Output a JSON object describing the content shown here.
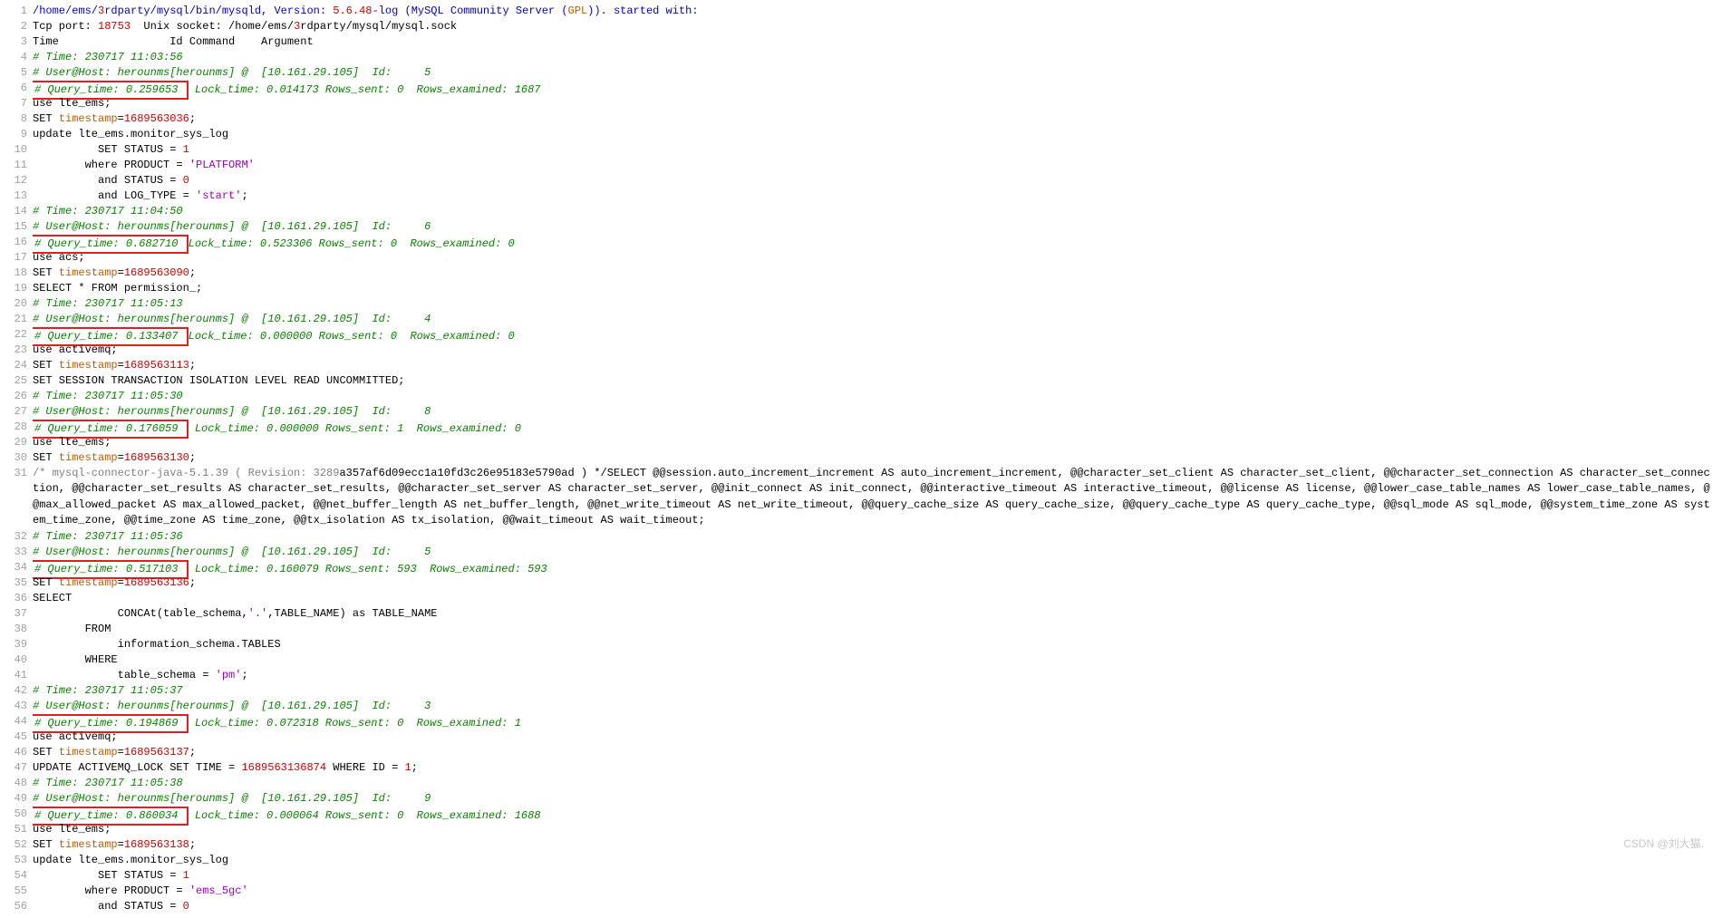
{
  "watermark": "CSDN @刘大猫.",
  "lines": [
    {
      "n": 1,
      "cls": "",
      "html": [
        {
          "t": "/home/ems/",
          "c": "blue"
        },
        {
          "t": "3",
          "c": "red"
        },
        {
          "t": "rdparty/mysql/bin/mysqld, Version: ",
          "c": "blue"
        },
        {
          "t": "5.6.48",
          "c": "red"
        },
        {
          "t": "-log (MySQL Community Server (",
          "c": "blue"
        },
        {
          "t": "GPL",
          "c": "orange"
        },
        {
          "t": ")). started with:",
          "c": "blue"
        }
      ]
    },
    {
      "n": 2,
      "cls": "",
      "html": [
        {
          "t": "Tcp port: ",
          "c": ""
        },
        {
          "t": "18753",
          "c": "red"
        },
        {
          "t": "  Unix socket: /home/ems/",
          "c": ""
        },
        {
          "t": "3",
          "c": "red"
        },
        {
          "t": "rdparty/mysql/mysql.sock",
          "c": ""
        }
      ]
    },
    {
      "n": 3,
      "cls": "",
      "html": [
        {
          "t": "Time                 Id Command    Argument",
          "c": ""
        }
      ]
    },
    {
      "n": 4,
      "cls": "green",
      "html": [
        {
          "t": "# Time: 230717 11:03:56",
          "c": "green"
        }
      ]
    },
    {
      "n": 5,
      "cls": "green",
      "html": [
        {
          "t": "# User@Host: herounms[herounms] @  [10.161.29.105]  Id:     5",
          "c": "green"
        }
      ]
    },
    {
      "n": 6,
      "cls": "green",
      "box": "# Query_time: 0.259653 ",
      "rest": " Lock_time: 0.014173 Rows_sent: 0  Rows_examined: 1687"
    },
    {
      "n": 7,
      "cls": "",
      "html": [
        {
          "t": "use lte_ems;",
          "c": ""
        }
      ]
    },
    {
      "n": 8,
      "cls": "",
      "html": [
        {
          "t": "SET ",
          "c": ""
        },
        {
          "t": "timestamp",
          "c": "orange"
        },
        {
          "t": "=",
          "c": ""
        },
        {
          "t": "1689563036",
          "c": "red"
        },
        {
          "t": ";",
          "c": ""
        }
      ]
    },
    {
      "n": 9,
      "cls": "",
      "html": [
        {
          "t": "update lte_ems.monitor_sys_log",
          "c": ""
        }
      ]
    },
    {
      "n": 10,
      "cls": "",
      "html": [
        {
          "t": "          SET STATUS = ",
          "c": ""
        },
        {
          "t": "1",
          "c": "red"
        }
      ]
    },
    {
      "n": 11,
      "cls": "",
      "html": [
        {
          "t": "        where PRODUCT = ",
          "c": ""
        },
        {
          "t": "'PLATFORM'",
          "c": "purple"
        }
      ]
    },
    {
      "n": 12,
      "cls": "",
      "html": [
        {
          "t": "          and STATUS = ",
          "c": ""
        },
        {
          "t": "0",
          "c": "red"
        }
      ]
    },
    {
      "n": 13,
      "cls": "",
      "html": [
        {
          "t": "          and LOG_TYPE = ",
          "c": ""
        },
        {
          "t": "'start'",
          "c": "purple"
        },
        {
          "t": ";",
          "c": ""
        }
      ]
    },
    {
      "n": 14,
      "cls": "green",
      "html": [
        {
          "t": "# Time: 230717 11:04:50",
          "c": "green"
        }
      ]
    },
    {
      "n": 15,
      "cls": "green",
      "html": [
        {
          "t": "# User@Host: herounms[herounms] @  [10.161.29.105]  Id:     6",
          "c": "green"
        }
      ]
    },
    {
      "n": 16,
      "cls": "green",
      "box": "# Query_time: 0.682710 ",
      "rest": "Lock_time: 0.523306 Rows_sent: 0  Rows_examined: 0"
    },
    {
      "n": 17,
      "cls": "",
      "html": [
        {
          "t": "use acs;",
          "c": ""
        }
      ]
    },
    {
      "n": 18,
      "cls": "",
      "html": [
        {
          "t": "SET ",
          "c": ""
        },
        {
          "t": "timestamp",
          "c": "orange"
        },
        {
          "t": "=",
          "c": ""
        },
        {
          "t": "1689563090",
          "c": "red"
        },
        {
          "t": ";",
          "c": ""
        }
      ]
    },
    {
      "n": 19,
      "cls": "",
      "html": [
        {
          "t": "SELECT * FROM permission_;",
          "c": ""
        }
      ]
    },
    {
      "n": 20,
      "cls": "green",
      "html": [
        {
          "t": "# Time: 230717 11:05:13",
          "c": "green"
        }
      ]
    },
    {
      "n": 21,
      "cls": "green",
      "html": [
        {
          "t": "# User@Host: herounms[herounms] @  [10.161.29.105]  Id:     4",
          "c": "green"
        }
      ]
    },
    {
      "n": 22,
      "cls": "green",
      "box": "# Query_time: 0.133407 ",
      "rest": "Lock_time: 0.000000 Rows_sent: 0  Rows_examined: 0"
    },
    {
      "n": 23,
      "cls": "",
      "html": [
        {
          "t": "use activemq;",
          "c": ""
        }
      ]
    },
    {
      "n": 24,
      "cls": "",
      "html": [
        {
          "t": "SET ",
          "c": ""
        },
        {
          "t": "timestamp",
          "c": "orange"
        },
        {
          "t": "=",
          "c": ""
        },
        {
          "t": "1689563113",
          "c": "red"
        },
        {
          "t": ";",
          "c": ""
        }
      ]
    },
    {
      "n": 25,
      "cls": "",
      "html": [
        {
          "t": "SET SESSION TRANSACTION ISOLATION LEVEL READ UNCOMMITTED;",
          "c": ""
        }
      ]
    },
    {
      "n": 26,
      "cls": "green",
      "html": [
        {
          "t": "# Time: 230717 11:05:30",
          "c": "green"
        }
      ]
    },
    {
      "n": 27,
      "cls": "green",
      "html": [
        {
          "t": "# User@Host: herounms[herounms] @  [10.161.29.105]  Id:     8",
          "c": "green"
        }
      ]
    },
    {
      "n": 28,
      "cls": "green",
      "box": "# Query_time: 0.176059 ",
      "rest": " Lock_time: 0.000000 Rows_sent: 1  Rows_examined: 0"
    },
    {
      "n": 29,
      "cls": "",
      "html": [
        {
          "t": "use lte_ems;",
          "c": ""
        }
      ]
    },
    {
      "n": 30,
      "cls": "",
      "html": [
        {
          "t": "SET ",
          "c": ""
        },
        {
          "t": "timestamp",
          "c": "orange"
        },
        {
          "t": "=",
          "c": ""
        },
        {
          "t": "1689563130",
          "c": "red"
        },
        {
          "t": ";",
          "c": ""
        }
      ]
    },
    {
      "n": 31,
      "cls": "wrap",
      "html": [
        {
          "t": "/* mysql-connector-java-5.1.39 ( Revision: 3289",
          "c": "gray"
        },
        {
          "t": "a357af6d09ecc1a10fd3c26e95183e5790ad ) */SELECT  @@session.auto_increment_increment AS auto_increment_increment, @@character_set_client AS character_set_client, @@character_set_connection AS character_set_connection, @@character_set_results AS character_set_results, @@character_set_server AS character_set_server, @@init_connect AS init_connect, @@interactive_timeout AS interactive_timeout, @@license AS license, @@lower_case_table_names AS lower_case_table_names, @@max_allowed_packet AS max_allowed_packet, @@net_buffer_length AS net_buffer_length, @@net_write_timeout AS net_write_timeout, @@query_cache_size AS query_cache_size, @@query_cache_type AS query_cache_type, @@sql_mode AS sql_mode, @@system_time_zone AS system_time_zone, @@time_zone AS time_zone, @@tx_isolation AS tx_isolation, @@wait_timeout AS wait_timeout;",
          "c": ""
        }
      ]
    },
    {
      "n": 32,
      "cls": "green",
      "html": [
        {
          "t": "# Time: 230717 11:05:36",
          "c": "green"
        }
      ]
    },
    {
      "n": 33,
      "cls": "green",
      "html": [
        {
          "t": "# User@Host: herounms[herounms] @  [10.161.29.105]  Id:     5",
          "c": "green"
        }
      ]
    },
    {
      "n": 34,
      "cls": "green",
      "box": "# Query_time: 0.517103 ",
      "rest": " Lock_time: 0.160079 Rows_sent: 593  Rows_examined: 593"
    },
    {
      "n": 35,
      "cls": "",
      "html": [
        {
          "t": "SET ",
          "c": ""
        },
        {
          "t": "timestamp",
          "c": "orange"
        },
        {
          "t": "=",
          "c": ""
        },
        {
          "t": "1689563136",
          "c": "red"
        },
        {
          "t": ";",
          "c": ""
        }
      ]
    },
    {
      "n": 36,
      "cls": "",
      "html": [
        {
          "t": "SELECT",
          "c": ""
        }
      ]
    },
    {
      "n": 37,
      "cls": "",
      "html": [
        {
          "t": "             CONCAt(table_schema,",
          "c": ""
        },
        {
          "t": "'.'",
          "c": "purple"
        },
        {
          "t": ",TABLE_NAME) as TABLE_NAME",
          "c": ""
        }
      ]
    },
    {
      "n": 38,
      "cls": "",
      "html": [
        {
          "t": "        FROM",
          "c": ""
        }
      ]
    },
    {
      "n": 39,
      "cls": "",
      "html": [
        {
          "t": "             information_schema.TABLES",
          "c": ""
        }
      ]
    },
    {
      "n": 40,
      "cls": "",
      "html": [
        {
          "t": "        WHERE",
          "c": ""
        }
      ]
    },
    {
      "n": 41,
      "cls": "",
      "html": [
        {
          "t": "             table_schema = ",
          "c": ""
        },
        {
          "t": "'pm'",
          "c": "purple"
        },
        {
          "t": ";",
          "c": ""
        }
      ]
    },
    {
      "n": 42,
      "cls": "green",
      "html": [
        {
          "t": "# Time: 230717 11:05:37",
          "c": "green"
        }
      ]
    },
    {
      "n": 43,
      "cls": "green",
      "html": [
        {
          "t": "# User@Host: herounms[herounms] @  [10.161.29.105]  Id:     3",
          "c": "green"
        }
      ]
    },
    {
      "n": 44,
      "cls": "green",
      "box": "# Query_time: 0.194869 ",
      "rest": " Lock_time: 0.072318 Rows_sent: 0  Rows_examined: 1"
    },
    {
      "n": 45,
      "cls": "",
      "html": [
        {
          "t": "use activemq;",
          "c": ""
        }
      ]
    },
    {
      "n": 46,
      "cls": "",
      "html": [
        {
          "t": "SET ",
          "c": ""
        },
        {
          "t": "timestamp",
          "c": "orange"
        },
        {
          "t": "=",
          "c": ""
        },
        {
          "t": "1689563137",
          "c": "red"
        },
        {
          "t": ";",
          "c": ""
        }
      ]
    },
    {
      "n": 47,
      "cls": "",
      "html": [
        {
          "t": "UPDATE ACTIVEMQ_LOCK SET TIME = ",
          "c": ""
        },
        {
          "t": "1689563136874",
          "c": "red"
        },
        {
          "t": " WHERE ID = ",
          "c": ""
        },
        {
          "t": "1",
          "c": "red"
        },
        {
          "t": ";",
          "c": ""
        }
      ]
    },
    {
      "n": 48,
      "cls": "green",
      "html": [
        {
          "t": "# Time: 230717 11:05:38",
          "c": "green"
        }
      ]
    },
    {
      "n": 49,
      "cls": "green",
      "html": [
        {
          "t": "# User@Host: herounms[herounms] @  [10.161.29.105]  Id:     9",
          "c": "green"
        }
      ]
    },
    {
      "n": 50,
      "cls": "green",
      "box": "# Query_time: 0.860034 ",
      "rest": " Lock_time: 0.000064 Rows_sent: 0  Rows_examined: 1688"
    },
    {
      "n": 51,
      "cls": "",
      "html": [
        {
          "t": "use lte_ems;",
          "c": ""
        }
      ]
    },
    {
      "n": 52,
      "cls": "",
      "html": [
        {
          "t": "SET ",
          "c": ""
        },
        {
          "t": "timestamp",
          "c": "orange"
        },
        {
          "t": "=",
          "c": ""
        },
        {
          "t": "1689563138",
          "c": "red"
        },
        {
          "t": ";",
          "c": ""
        }
      ]
    },
    {
      "n": 53,
      "cls": "",
      "html": [
        {
          "t": "update lte_ems.monitor_sys_log",
          "c": ""
        }
      ]
    },
    {
      "n": 54,
      "cls": "",
      "html": [
        {
          "t": "          SET STATUS = ",
          "c": ""
        },
        {
          "t": "1",
          "c": "red"
        }
      ]
    },
    {
      "n": 55,
      "cls": "",
      "html": [
        {
          "t": "        where PRODUCT = ",
          "c": ""
        },
        {
          "t": "'ems_5gc'",
          "c": "purple"
        }
      ]
    },
    {
      "n": 56,
      "cls": "",
      "html": [
        {
          "t": "          and STATUS = ",
          "c": ""
        },
        {
          "t": "0",
          "c": "red"
        }
      ]
    }
  ]
}
